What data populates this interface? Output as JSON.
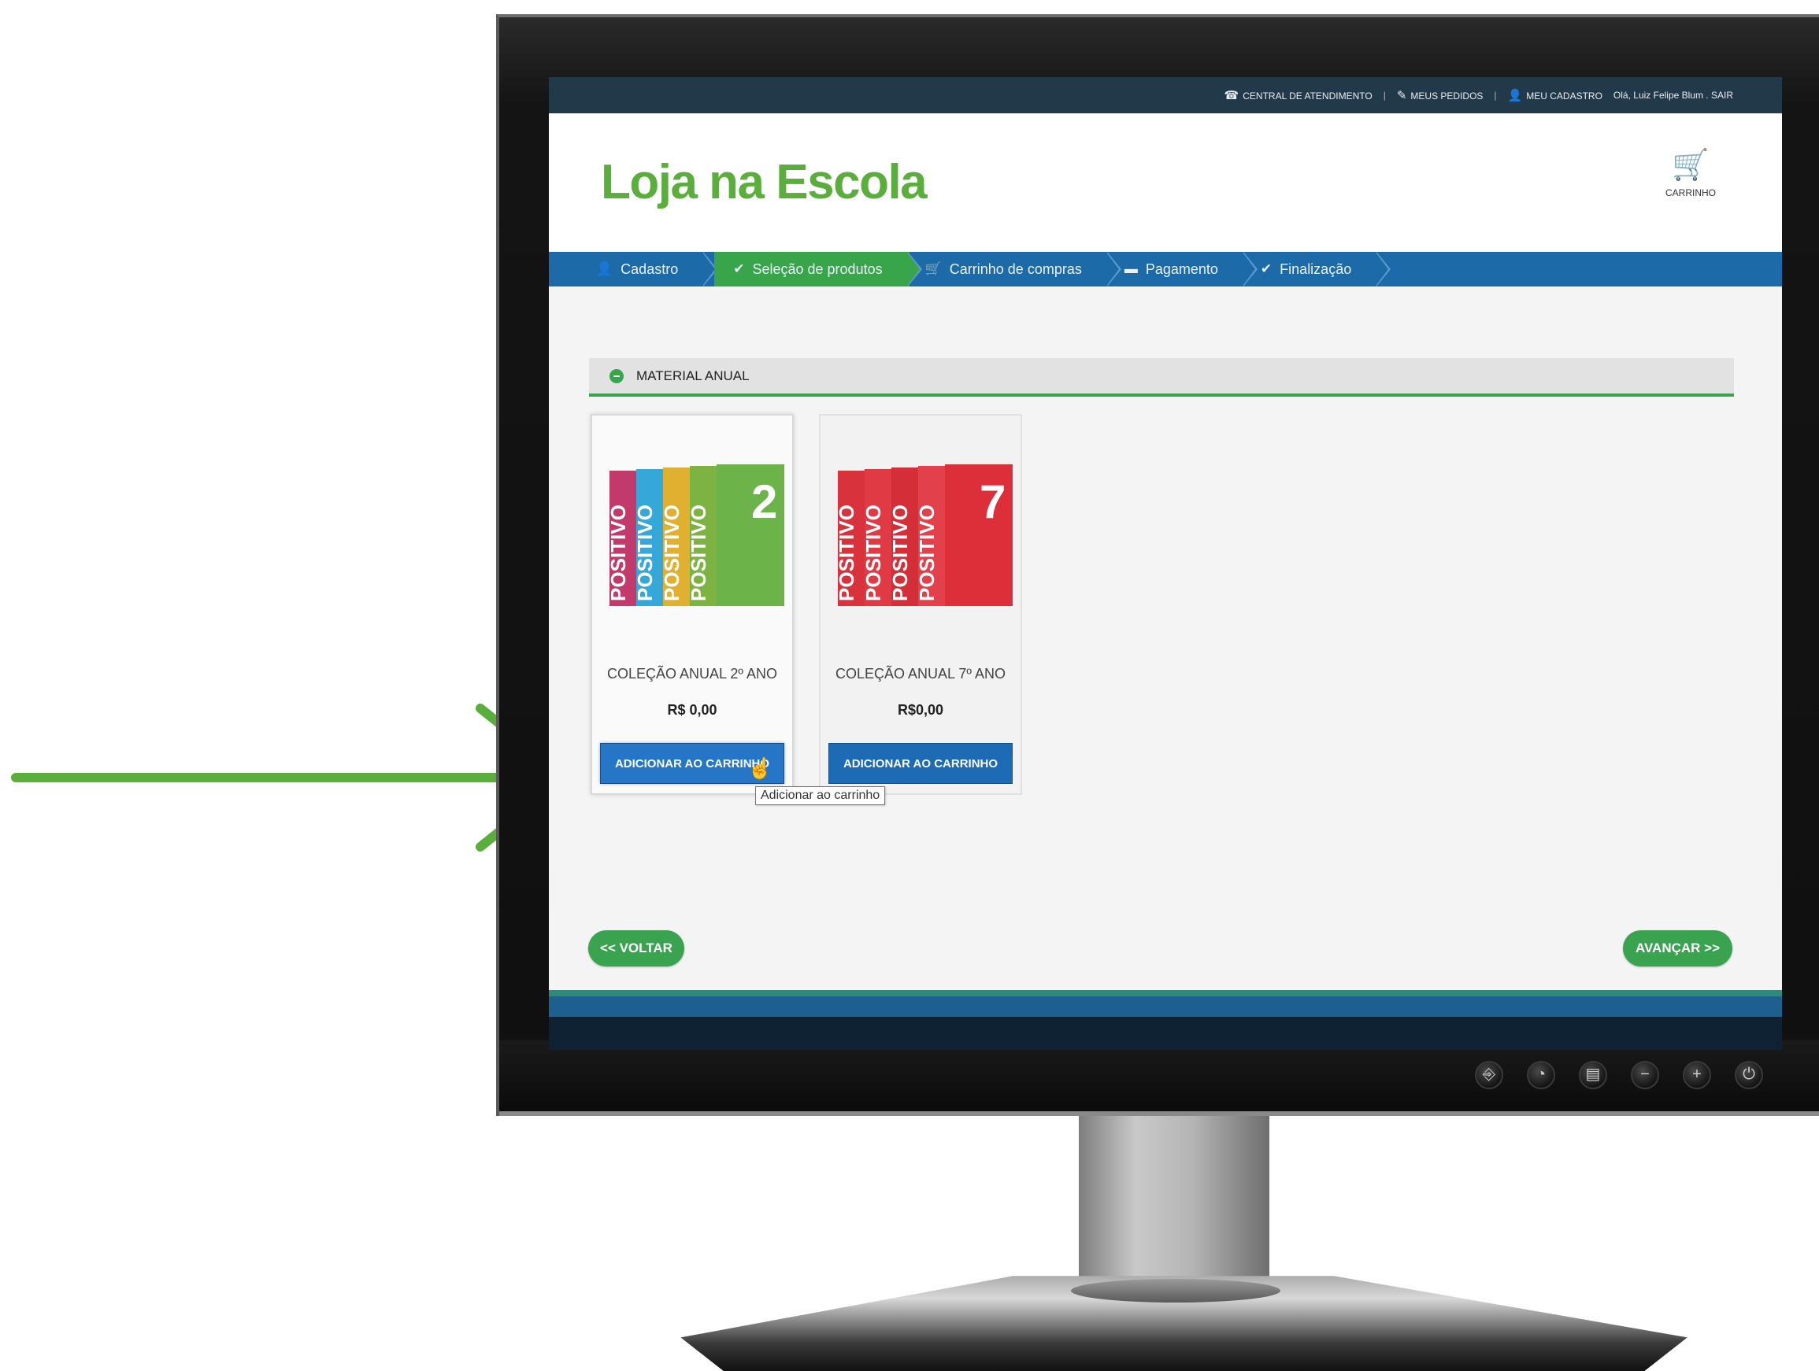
{
  "topbar": {
    "service": "CENTRAL DE ATENDIMENTO",
    "orders": "MEUS PEDIDOS",
    "profile": "MEU CADASTRO",
    "greeting": "Olá, Luiz Felipe Blum",
    "logout": "SAIR",
    "separator": "|"
  },
  "header": {
    "logo": "Loja na Escola",
    "cart_label": "CARRINHO"
  },
  "steps": [
    {
      "label": "Cadastro",
      "icon": "user-icon"
    },
    {
      "label": "Seleção de produtos",
      "icon": "check-circle-icon",
      "active": true
    },
    {
      "label": "Carrinho de compras",
      "icon": "cart-icon"
    },
    {
      "label": "Pagamento",
      "icon": "card-icon"
    },
    {
      "label": "Finalização",
      "icon": "check-circle-icon"
    }
  ],
  "section": {
    "title": "MATERIAL ANUAL"
  },
  "products": [
    {
      "name": "COLEÇÃO ANUAL 2º ANO",
      "price": "R$ 0,00",
      "button": "ADICIONAR AO CARRINHO",
      "book_number": "2",
      "book_text": "POSITIVO"
    },
    {
      "name": "COLEÇÃO ANUAL 7º ANO",
      "price": "R$0,00",
      "button": "ADICIONAR AO CARRINHO",
      "book_number": "7",
      "book_text": "POSITIVO"
    }
  ],
  "tooltip": "Adicionar ao carrinho",
  "nav": {
    "back": "<< VOLTAR",
    "next": "AVANÇAR >>"
  },
  "colors": {
    "brand_green": "#5aae3c",
    "step_blue": "#1d6aa8",
    "active_green": "#39a54a",
    "button_blue": "#1d6bb5",
    "topbar": "#22394a",
    "arrow": "#5aae3c"
  }
}
